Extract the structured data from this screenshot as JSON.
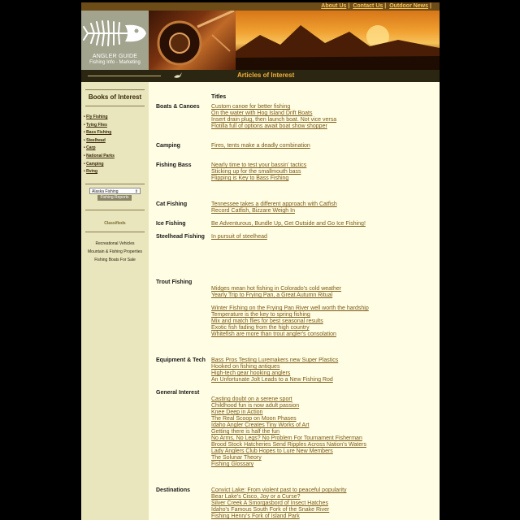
{
  "top_links": [
    "About Us",
    "Contact Us",
    "Outdoor News"
  ],
  "logo": {
    "title": "ANGLER GUIDE",
    "subtitle": "Fishing Info - Marketing"
  },
  "banner_title": "Articles of Interest",
  "sidebar": {
    "books_title": "Books of Interest",
    "books": [
      "Fly Fishing",
      "Tying Flies",
      "Bass Fishing",
      "Steelhead",
      "Carp",
      "National Parks",
      "Camping",
      "Rving"
    ],
    "region_select": "Alaska Fishing",
    "reports_button": "Fishing Reports",
    "classifieds_title": "Classifieds",
    "classifieds": [
      "Recreational Vehicles",
      "Mountain & Fishing Properties",
      "Fishing Boats For Sale"
    ]
  },
  "content": {
    "titles_heading": "Titles",
    "sections": [
      {
        "category": "Boats & Canoes",
        "links": [
          "Custom canoe for better fishing",
          "On the water with Hog Island Drift Boats",
          "Insert drain plug, then launch boat. Not vice versa",
          "Flotilla full of options await boat show shopper"
        ]
      },
      {
        "category": "Camping",
        "links": [
          "Fires, tents make a deadly combination"
        ]
      },
      {
        "category": "Fishing Bass",
        "links": [
          "Nearly time to test your bassin' tactics",
          "Sticking up for the smallmouth bass",
          "Flipping is Key to Bass Fishing"
        ]
      },
      {
        "category": "Cat Fishing",
        "links": [
          "Tennessee takes a different approach with Catfish",
          "Record Catfish, Bizzare Weigh In"
        ]
      },
      {
        "category": "Ice Fishing",
        "links": [
          "Be Adventurous, Bundle Up, Get Outside and Go Ice Fishing!"
        ]
      },
      {
        "category": "Steelhead Fishing",
        "links": [
          "In pursuit of steelhead"
        ]
      },
      {
        "category": "Trout Fishing",
        "links": [
          "",
          "Midges mean hot fishing in Colorado's cold weather",
          "Yearly Trip to Frying Pan, a Great Autumn Ritual",
          "",
          "Winter Fishing on the Frying Pan River well worth the hardship",
          "Temperature is the key to spring fishing",
          "Mix and match flies for best seasonal results",
          "Exotic fish fading from the high country",
          "Whitefish are more than trout angler's consolation"
        ]
      },
      {
        "category": "Equipment & Tech",
        "links": [
          "Bass Pros Testing Luremakers new Super Plastics",
          "Hooked on fishing antiques",
          "High-tech gear hooking anglers",
          "An Unfortunate Jolt Leads to a New Fishing Rod"
        ]
      },
      {
        "category": "General Interest",
        "links": [
          "",
          "Casting doubt on a serene sport",
          "Childhood fun is now adult passion",
          "Knee Deep in Action",
          "The Real Scoop on Moon Phases",
          "Idaho Angler Creates Tiny Works of Art",
          "Getting there is half the fun",
          "No Arms, No Legs? No Problem For Tournament Fisherman",
          "Brood Stock Hatcheries Send Ripples Across Nation's Waters",
          "Lady Anglers Club Hopes to Lure New Members",
          "The Solunar Theory",
          "Fishing Glossary"
        ]
      },
      {
        "category": "Destinations",
        "links": [
          "Convict Lake: From violent past to peaceful popularity",
          "Bear Lake's Cisco, Joy or a Curse?",
          "Silver Creek A Smorgasbord of Insect Hatches",
          "Idaho's Famous South Fork of the Snake River",
          "Fishing Henry's Fork of Island Park"
        ]
      }
    ]
  },
  "colors": {
    "page_bg": "#000000",
    "content_bg": "#fffde3",
    "sidebar_bg": "#e9e6bd",
    "link": "#7a5a18",
    "accent": "#f2b13b"
  }
}
